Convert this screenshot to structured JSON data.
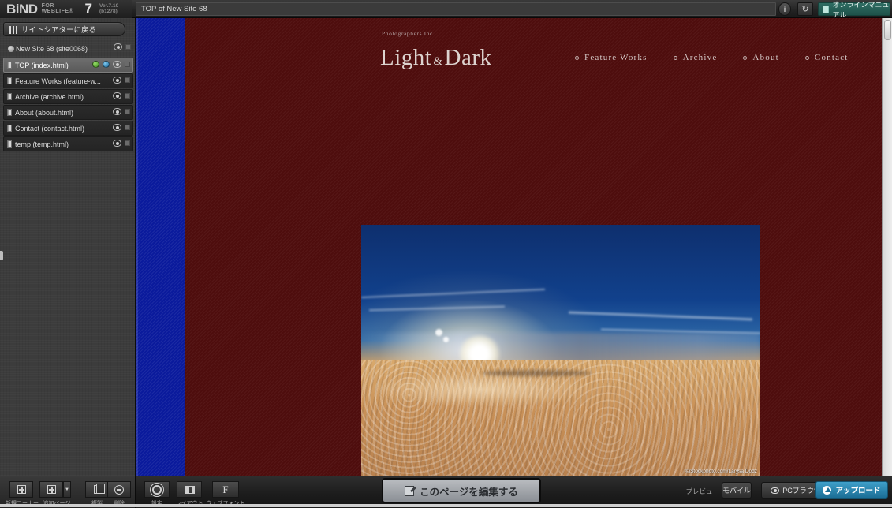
{
  "app": {
    "brand": "BiND",
    "brand_sub": "FOR WEBLIFE®",
    "brand_version_num": "7",
    "version": "Ver.7.10 (b1278)",
    "title_field_value": "TOP of New Site 68",
    "info_icon": "info-icon",
    "reload_icon": "reload-icon",
    "manual_label": "オンラインマニュアル"
  },
  "sidebar": {
    "back_button": "サイトシアターに戻る",
    "site": {
      "label": "New Site 68 (site0068)",
      "eye_icon": "eye-icon",
      "square_icon": "square-icon"
    },
    "pages": [
      {
        "label": "TOP (index.html)",
        "selected": true,
        "badges": [
          "green-badge",
          "blue-badge"
        ]
      },
      {
        "label": "Feature Works (feature-w...",
        "selected": false,
        "badges": []
      },
      {
        "label": "Archive (archive.html)",
        "selected": false,
        "badges": []
      },
      {
        "label": "About (about.html)",
        "selected": false,
        "badges": []
      },
      {
        "label": "Contact (contact.html)",
        "selected": false,
        "badges": []
      },
      {
        "label": "temp (temp.html)",
        "selected": false,
        "badges": []
      }
    ]
  },
  "preview_site": {
    "supertitle": "Photographers Inc.",
    "title_left": "Light",
    "title_amp": "&",
    "title_right": "Dark",
    "nav": [
      {
        "label": "Feature Works"
      },
      {
        "label": "Archive"
      },
      {
        "label": "About"
      },
      {
        "label": "Contact"
      }
    ],
    "hero_credit": "©iStockphoto.com/Larysa Dodz",
    "colors": {
      "page_background": "#4e0d0d",
      "side_band": "#0a1a9c",
      "title_text": "#ddd3cf"
    }
  },
  "bottom_bar": {
    "tools_left": [
      {
        "label": "新規コーナー",
        "icon": "new-corner-icon"
      },
      {
        "label": "追加ページ",
        "icon": "add-page-icon"
      }
    ],
    "tools_mid": [
      {
        "label": "複製",
        "icon": "duplicate-icon"
      },
      {
        "label": "削除",
        "icon": "delete-icon"
      }
    ],
    "tools_right": [
      {
        "label": "設定",
        "icon": "gear-icon"
      },
      {
        "label": "レイアウト",
        "icon": "layout-icon"
      },
      {
        "label": "ウェブフォント",
        "icon": "webfont-icon"
      }
    ],
    "webfont_glyph": "F",
    "edit_page_label": "このページを編集する",
    "preview_label": "プレビュー",
    "mobile_label": "モバイル",
    "pc_browser_label": "PCブラウザ",
    "upload_label": "アップロード",
    "accent_upload": "#2a86b0"
  }
}
